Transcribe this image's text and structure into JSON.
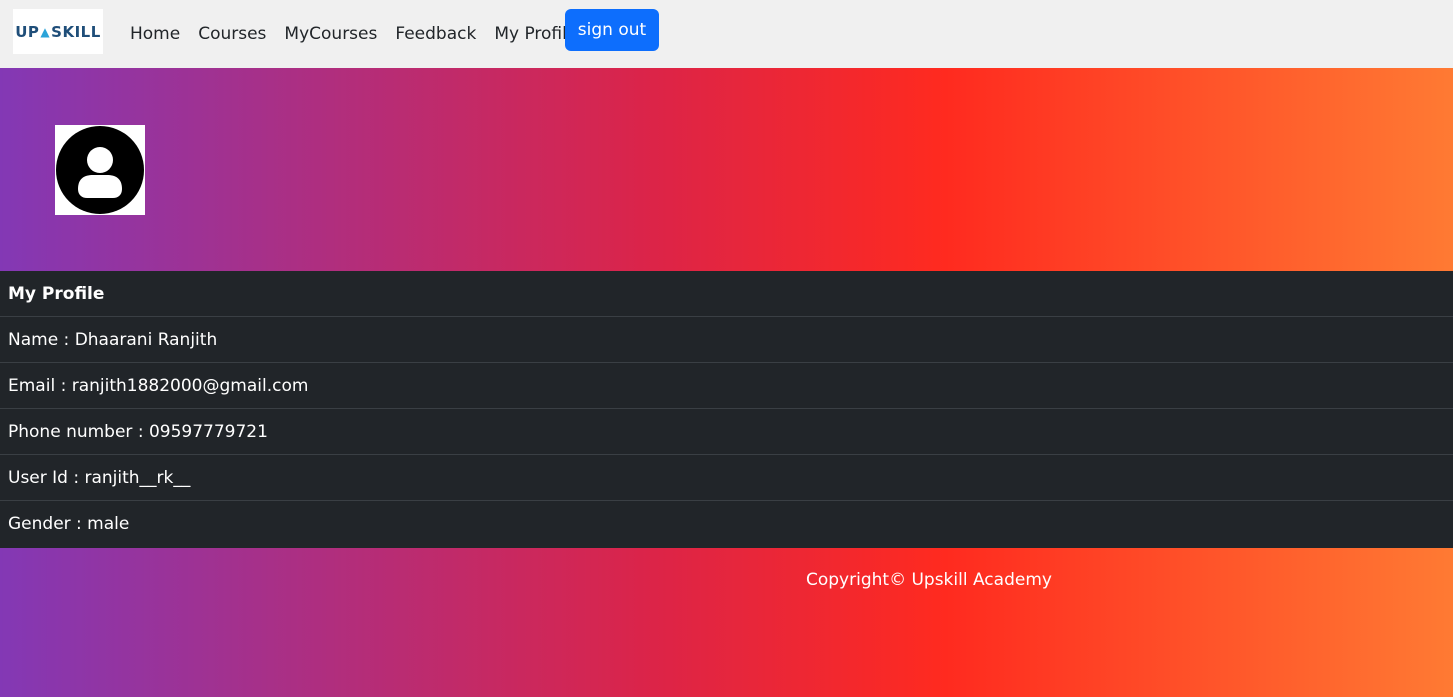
{
  "navbar": {
    "logo_text_left": "UP",
    "logo_text_right": "SKILL",
    "links": [
      "Home",
      "Courses",
      "MyCourses",
      "Feedback",
      "My Profile"
    ],
    "signout_label": "sign out",
    "accent_color": "#0d6efd"
  },
  "hero": {
    "avatar_icon": "user-circle-icon"
  },
  "profile": {
    "heading": "My Profile",
    "name": "Name : Dhaarani Ranjith",
    "email": "Email : ranjith1882000@gmail.com",
    "phone": "Phone number : 09597779721",
    "user_id": "User Id : ranjith__rk__",
    "gender": "Gender : male"
  },
  "footer": {
    "copyright": "Copyright© Upskill Academy"
  },
  "colors": {
    "gradient_start": "#8338b5",
    "gradient_mid": "#ff2a1f",
    "gradient_end": "#ff7a33",
    "table_bg": "#212529"
  }
}
